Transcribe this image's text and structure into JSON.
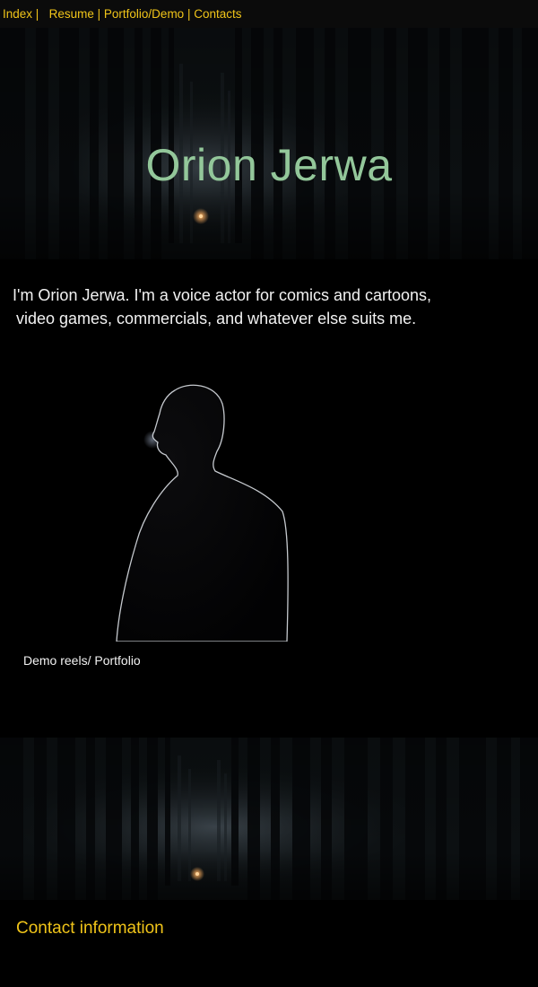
{
  "nav": {
    "items": [
      {
        "label": "Index"
      },
      {
        "label": "Resume"
      },
      {
        "label": "Portfolio/Demo"
      },
      {
        "label": "Contacts"
      }
    ],
    "separator": "|"
  },
  "hero": {
    "title": "Orion Jerwa"
  },
  "intro": {
    "line1": "I'm Orion Jerwa. I'm a voice actor for comics and cartoons,",
    "line2": "video games, commercials, and whatever else suits me."
  },
  "demo": {
    "label": "Demo reels/ Portfolio"
  },
  "contact": {
    "heading": "Contact information"
  },
  "colors": {
    "nav_text": "#f0c419",
    "hero_title": "#93c79a",
    "background": "#000000",
    "body_text": "#f2f2f2"
  }
}
